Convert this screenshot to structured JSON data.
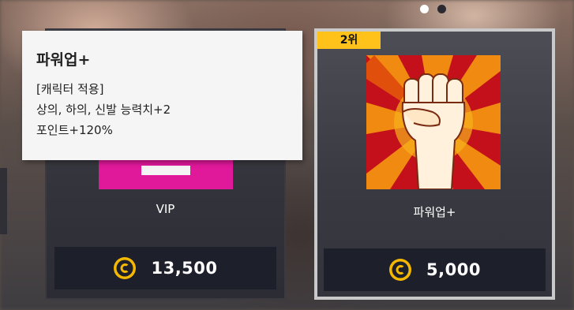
{
  "pager": {
    "pages": 2,
    "active_index": 0
  },
  "cards": [
    {
      "name": "VIP",
      "price": "13,500",
      "currency_icon": "coin-c-icon",
      "art_color": "#e0189a"
    },
    {
      "rank": "2위",
      "name": "파워업+",
      "price": "5,000",
      "currency_icon": "coin-c-icon",
      "art_icon": "raised-fist-icon",
      "selected": true
    }
  ],
  "tooltip": {
    "title": "파워업+",
    "lines": [
      "[캐릭터 적용]",
      "상의, 하의, 신발 능력치+2",
      "포인트+120%"
    ]
  },
  "colors": {
    "rank_badge": "#ffc21a",
    "coin": "#f5b800",
    "price_bar": "#1d1f2b"
  }
}
